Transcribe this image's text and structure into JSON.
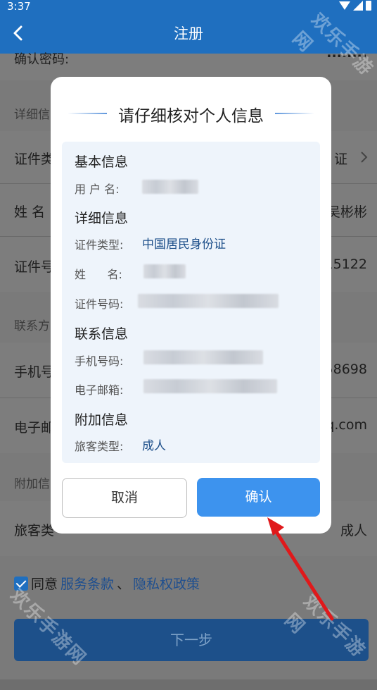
{
  "status_bar": {
    "time": "3:37"
  },
  "appbar": {
    "title": "注册"
  },
  "background": {
    "top_partial_label": "确认密码:",
    "top_partial_value": "........",
    "section_detail": "详细信",
    "row_id_type": {
      "label": "证件类",
      "value": "证"
    },
    "row_name": {
      "label": "姓 名",
      "value": "吴彬彬"
    },
    "row_id_no": {
      "label": "证件号",
      "value": "15122"
    },
    "section_contact": "联系方",
    "row_phone": {
      "label": "手机号",
      "value": "58698"
    },
    "row_email": {
      "label": "电子邮",
      "value": "q.com"
    },
    "section_extra": "附加信",
    "row_passenger": {
      "label": "旅客类",
      "value": "成人"
    },
    "agree": {
      "text": "同意",
      "terms": "服务条款",
      "sep": "、",
      "privacy": "隐私权政策"
    },
    "next_button": "下一步"
  },
  "watermark": "欢乐手游网",
  "dialog": {
    "title": "请仔细核对个人信息",
    "basic": {
      "heading": "基本信息",
      "username_label": "用 户 名:"
    },
    "detail": {
      "heading": "详细信息",
      "id_type_label": "证件类型:",
      "id_type_value": "中国居民身份证",
      "name_label": "姓      名:",
      "id_no_label": "证件号码:"
    },
    "contact": {
      "heading": "联系信息",
      "phone_label": "手机号码:",
      "email_label": "电子邮箱:"
    },
    "extra": {
      "heading": "附加信息",
      "passenger_label": "旅客类型:",
      "passenger_value": "成人"
    },
    "cancel_button": "取消",
    "confirm_button": "确认"
  },
  "colors": {
    "primary": "#1f6fbf",
    "confirm_button": "#3d93ee",
    "value_text": "#1d4f8a",
    "annotation_arrow": "#e0191b"
  }
}
